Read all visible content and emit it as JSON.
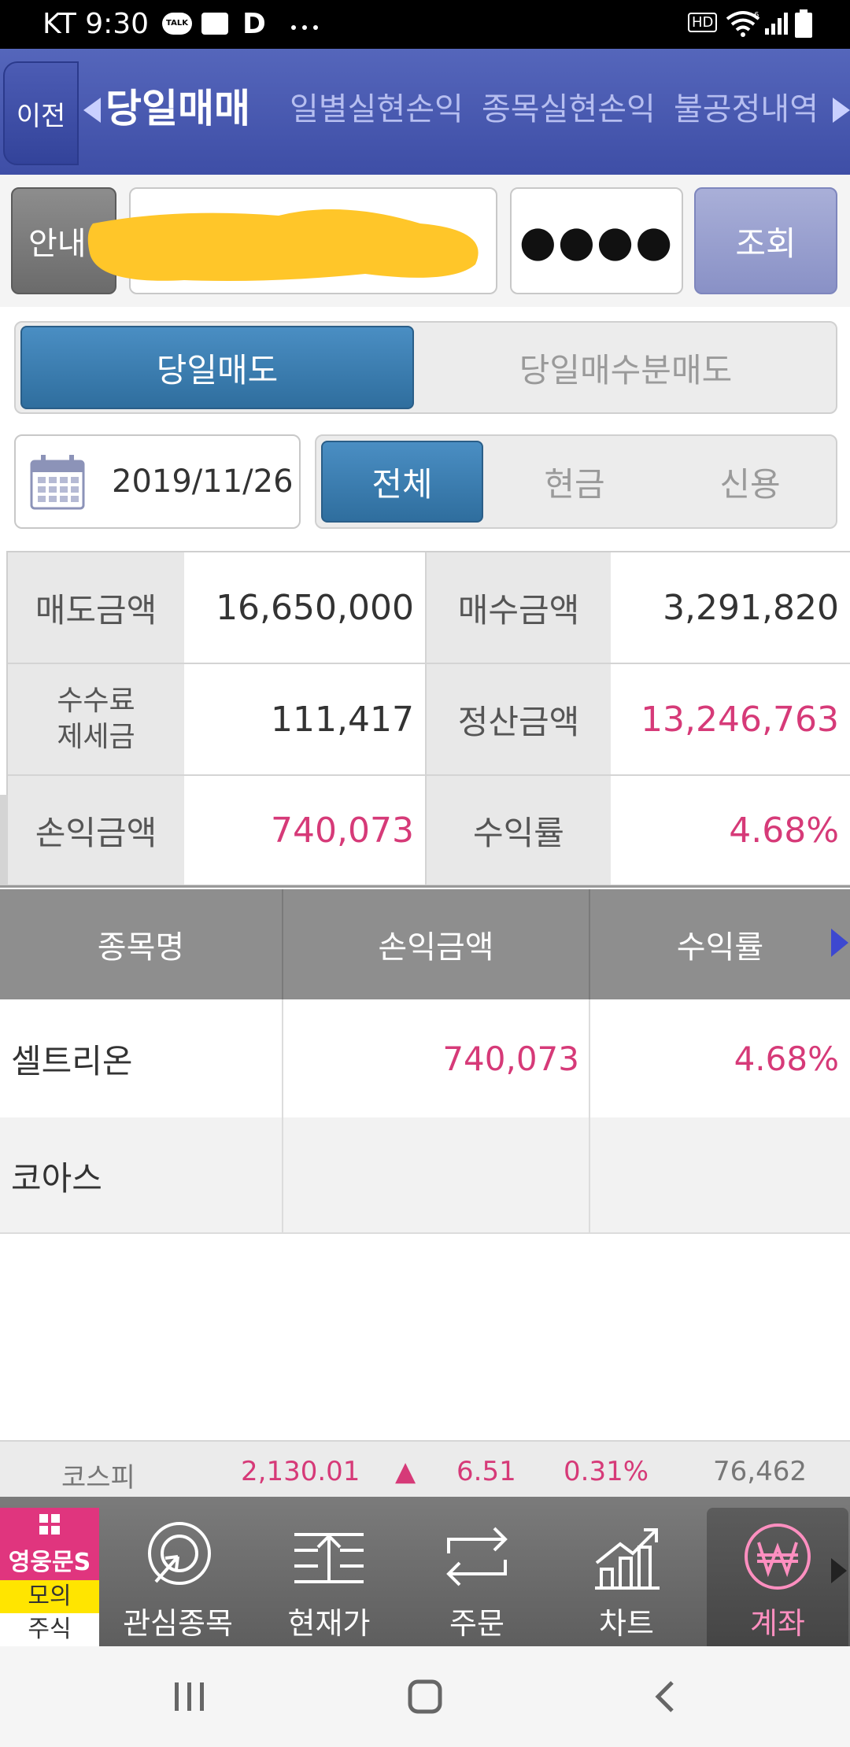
{
  "status_bar": {
    "carrier_time": "KT 9:30",
    "talk_badge": "TALK",
    "d_icon": "D",
    "hd_badge": "HD",
    "wifi_badge": "6"
  },
  "header": {
    "back_label": "이전",
    "tabs": [
      {
        "label": "당일매매",
        "active": true
      },
      {
        "label": "일별실현손익",
        "active": false
      },
      {
        "label": "종목실현손익",
        "active": false
      },
      {
        "label": "불공정내역",
        "active": false
      }
    ]
  },
  "account": {
    "guide_label": "안내",
    "password_mask": "●●●●",
    "query_label": "조회"
  },
  "sell_tabs": {
    "today_sell": "당일매도",
    "today_buy_sell": "당일매수분매도"
  },
  "filter": {
    "date": "2019/11/26",
    "all": "전체",
    "cash": "현금",
    "credit": "신용"
  },
  "summary": {
    "sell_amount_label": "매도금액",
    "sell_amount": "16,650,000",
    "buy_amount_label": "매수금액",
    "buy_amount": "3,291,820",
    "fee_label_1": "수수료",
    "fee_label_2": "제세금",
    "fee": "111,417",
    "settle_label": "정산금액",
    "settle": "13,246,763",
    "pnl_label": "손익금액",
    "pnl": "740,073",
    "rate_label": "수익률",
    "rate": "4.68%"
  },
  "table": {
    "headers": [
      "종목명",
      "손익금액",
      "수익률"
    ],
    "rows": [
      {
        "name": "셀트리온",
        "pnl": "740,073",
        "rate": "4.68%"
      },
      {
        "name": "코아스",
        "pnl": "",
        "rate": ""
      }
    ]
  },
  "ticker": {
    "index": "코스피",
    "value": "2,130.01",
    "arrow": "▲",
    "change": "6.51",
    "pct": "0.31%",
    "volume": "76,462"
  },
  "brand": {
    "logo_text": "영웅문S",
    "mock_1": "모의",
    "mock_2": "주식"
  },
  "nav": [
    {
      "label": "관심종목",
      "icon": "watchlist-icon"
    },
    {
      "label": "현재가",
      "icon": "current-price-icon"
    },
    {
      "label": "주문",
      "icon": "order-icon"
    },
    {
      "label": "차트",
      "icon": "chart-icon"
    },
    {
      "label": "계좌",
      "icon": "account-won-icon",
      "active": true
    }
  ],
  "colors": {
    "accent_pink": "#d63a78",
    "header_blue": "#3e4ea6",
    "segment_blue": "#2f6e9e"
  }
}
